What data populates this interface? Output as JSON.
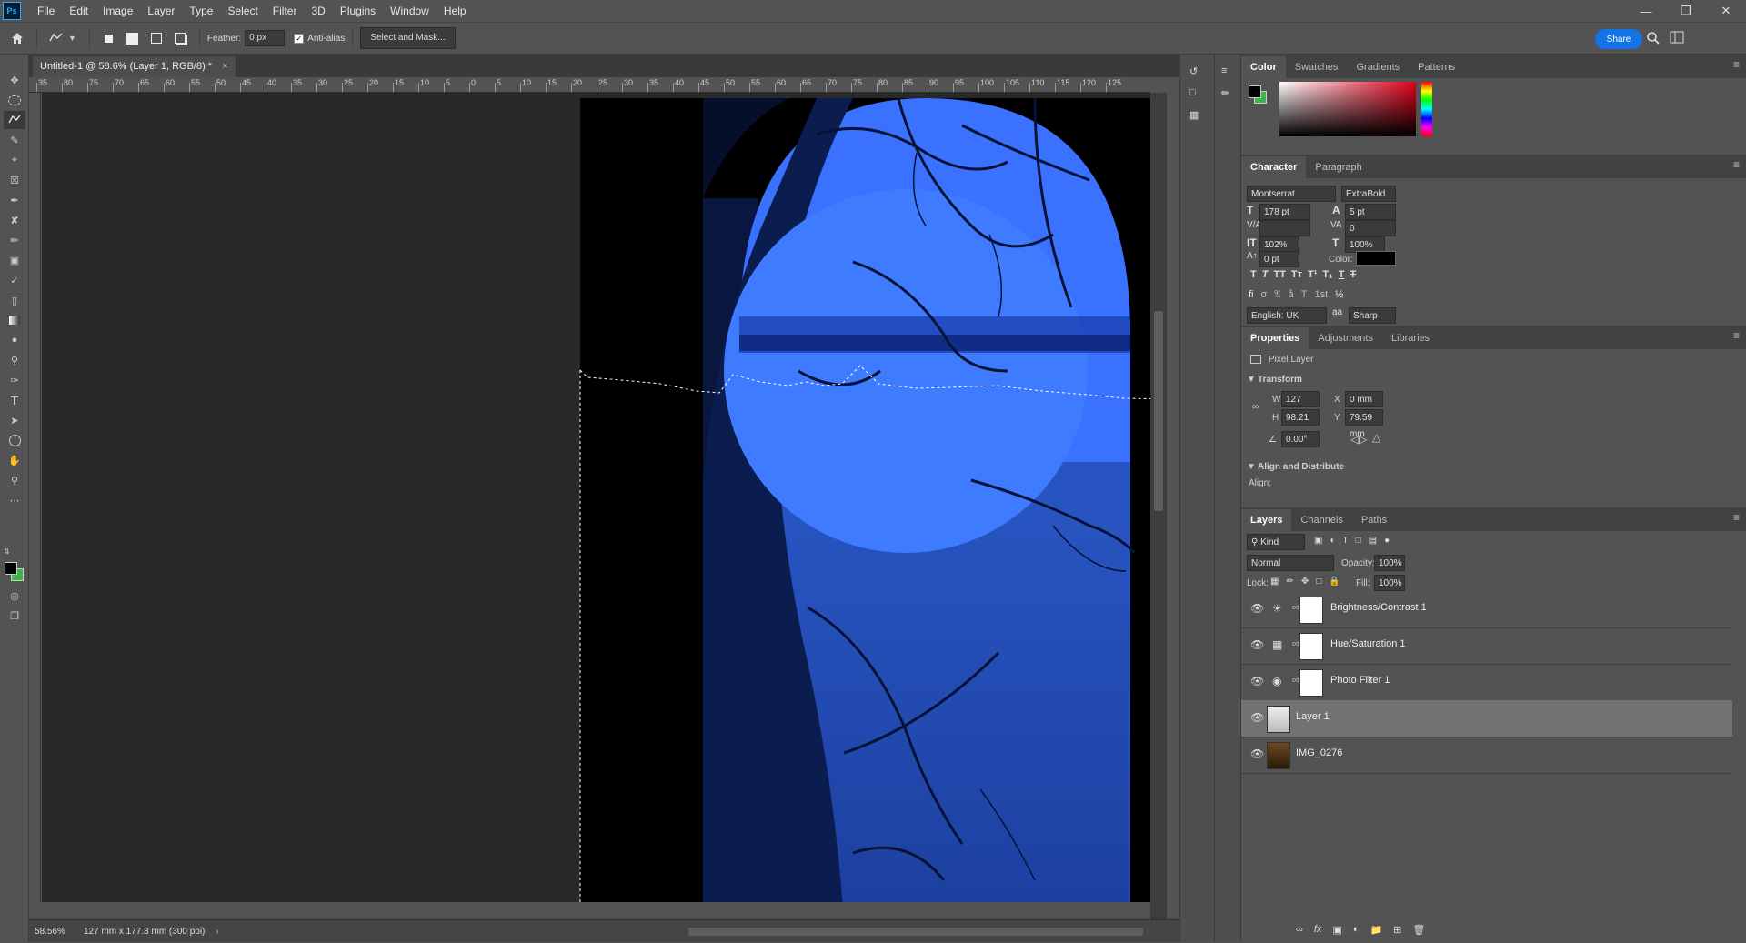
{
  "app": {
    "logo": "Ps"
  },
  "menu": [
    "File",
    "Edit",
    "Image",
    "Layer",
    "Type",
    "Select",
    "Filter",
    "3D",
    "Plugins",
    "Window",
    "Help"
  ],
  "options": {
    "feather_label": "Feather:",
    "feather_value": "0 px",
    "antialias_label": "Anti-alias",
    "select_mask_label": "Select and Mask...",
    "share_label": "Share"
  },
  "document": {
    "tab_title": "Untitled-1 @ 58.6% (Layer 1, RGB/8) *",
    "close_glyph": "×"
  },
  "ruler": {
    "labels": [
      "35",
      "80",
      "75",
      "70",
      "65",
      "60",
      "55",
      "50",
      "45",
      "40",
      "35",
      "30",
      "25",
      "20",
      "15",
      "10",
      "5",
      "0",
      "5",
      "10",
      "15",
      "20",
      "25",
      "30",
      "35",
      "40",
      "45",
      "50",
      "55",
      "60",
      "65",
      "70",
      "75",
      "80",
      "85",
      "90",
      "95",
      "100",
      "105",
      "110",
      "115",
      "120",
      "125"
    ]
  },
  "status": {
    "zoom": "58.56%",
    "doc_info": "127 mm x 177.8 mm (300 ppi)"
  },
  "color_panel": {
    "tabs": [
      "Color",
      "Swatches",
      "Gradients",
      "Patterns"
    ],
    "foreground": "#000000",
    "background": "#39b54a"
  },
  "character": {
    "tabs": [
      "Character",
      "Paragraph"
    ],
    "font_family": "Montserrat",
    "font_style": "ExtraBold",
    "size": "178 pt",
    "leading": "5 pt",
    "kerning": "",
    "tracking": "0",
    "vscale": "102%",
    "hscale": "100%",
    "baseline": "0 pt",
    "color_label": "Color:",
    "language": "English: UK",
    "antialias": "Sharp",
    "aa_glyph": "aa"
  },
  "properties": {
    "tabs": [
      "Properties",
      "Adjustments",
      "Libraries"
    ],
    "kind": "Pixel Layer",
    "transform_label": "Transform",
    "w_label": "W",
    "w": "127 mm",
    "h_label": "H",
    "h": "98.21 mm",
    "x_label": "X",
    "x": "0 mm",
    "y_label": "Y",
    "y": "79.59 mm",
    "angle": "0.00°",
    "align_label": "Align and Distribute",
    "align_sub": "Align:"
  },
  "layers_panel": {
    "tabs": [
      "Layers",
      "Channels",
      "Paths"
    ],
    "filter_kind": "Kind",
    "blend_mode": "Normal",
    "opacity_label": "Opacity:",
    "opacity": "100%",
    "lock_label": "Lock:",
    "fill_label": "Fill:",
    "fill": "100%",
    "layers": [
      {
        "name": "Brightness/Contrast 1",
        "icon": "sun-icon"
      },
      {
        "name": "Hue/Saturation 1",
        "icon": "hue-icon"
      },
      {
        "name": "Photo Filter 1",
        "icon": "camera-icon"
      },
      {
        "name": "Layer 1",
        "icon": "none"
      },
      {
        "name": "IMG_0276",
        "icon": "none"
      }
    ]
  }
}
